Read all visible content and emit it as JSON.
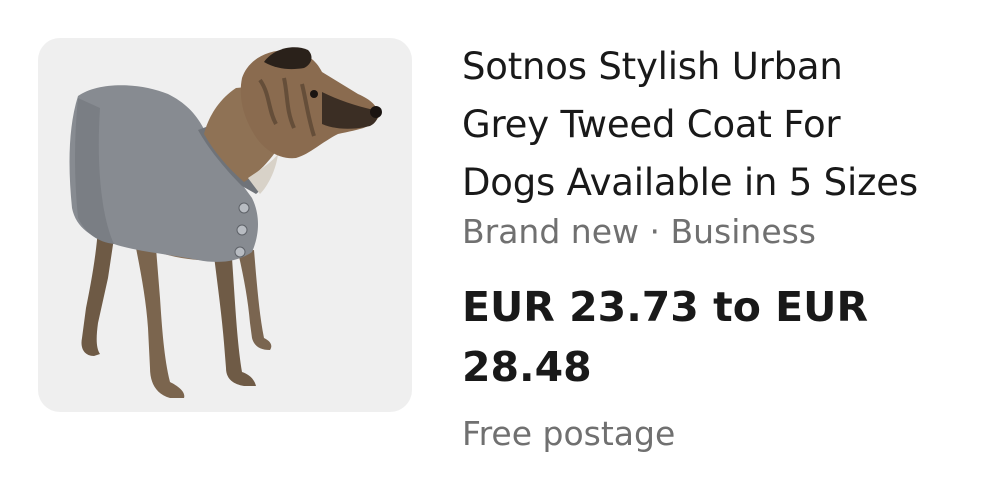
{
  "listing": {
    "image_alt": "dog wearing grey tweed coat",
    "title": "Sotnos Stylish Urban Grey Tweed Coat For Dogs Available in 5 Sizes",
    "condition": "Brand new",
    "separator": " · ",
    "seller_type": "Business",
    "price": "EUR 23.73 to EUR 28.48",
    "shipping": "Free postage"
  },
  "colors": {
    "text_primary": "#191919",
    "text_secondary": "#707070",
    "thumb_background": "#efefef",
    "coat": "#8a8e94"
  }
}
